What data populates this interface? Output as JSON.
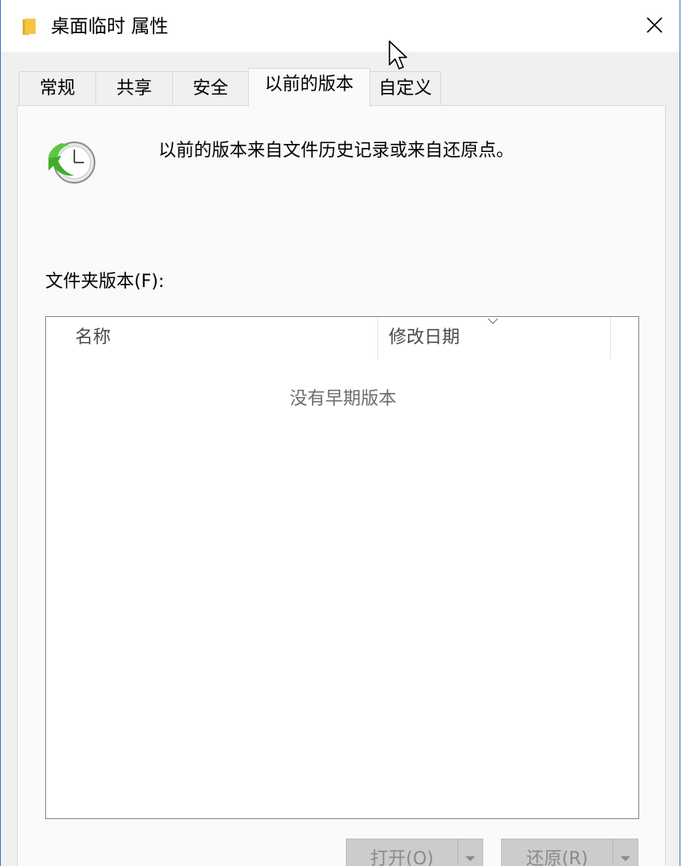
{
  "window": {
    "title": "桌面临时 属性"
  },
  "tabs": [
    {
      "label": "常规"
    },
    {
      "label": "共享"
    },
    {
      "label": "安全"
    },
    {
      "label": "以前的版本"
    },
    {
      "label": "自定义"
    }
  ],
  "active_tab_index": 3,
  "panel": {
    "description": "以前的版本来自文件历史记录或来自还原点。",
    "versions_label": "文件夹版本(F):",
    "list": {
      "columns": [
        "名称",
        "修改日期"
      ],
      "empty_message": "没有早期版本"
    },
    "buttons": {
      "open_label": "打开(O)",
      "restore_label": "还原(R)"
    }
  },
  "icons": {
    "title": "folder-icon",
    "close": "close-icon",
    "cursor": "mouse-cursor-icon",
    "panel": "restore-clock-icon"
  },
  "colors": {
    "window_border": "#2b79c9",
    "folder": "#f5c542",
    "restore_arrow": "#3fae2a"
  }
}
